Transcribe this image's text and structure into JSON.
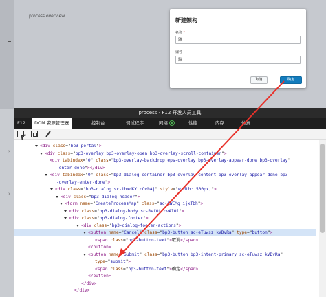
{
  "app": {
    "page_title": "process overview"
  },
  "dialog": {
    "title": "新建架构",
    "name_label": "名称",
    "required_mark": "*",
    "name_value": "跌",
    "code_label": "编号",
    "code_value": "跌",
    "cancel_label": "取消",
    "ok_label": "确定"
  },
  "devtools": {
    "window_title": "process - F12 开发人员工具",
    "tabs": [
      "F12",
      "DOM 资源管理器",
      "控制台",
      "调试程序",
      "网络",
      "性能",
      "内存",
      "仿真"
    ],
    "active_tab": "DOM 资源管理器",
    "dom_lines": [
      [
        [
          "tg",
          "<div "
        ],
        [
          "an",
          "class"
        ],
        [
          "tx",
          "=\""
        ],
        [
          "av",
          "bp3-portal"
        ],
        [
          "tx",
          "\""
        ],
        [
          "tg",
          ">"
        ]
      ],
      [
        [
          "tg",
          "<div "
        ],
        [
          "an",
          "class"
        ],
        [
          "tx",
          "=\""
        ],
        [
          "av",
          "bp3-overlay bp3-overlay-open bp3-overlay-scroll-container"
        ],
        [
          "tx",
          "\""
        ],
        [
          "tg",
          ">"
        ]
      ],
      [
        [
          "tg",
          "<div "
        ],
        [
          "an",
          "tabindex"
        ],
        [
          "tx",
          "=\""
        ],
        [
          "av",
          "0"
        ],
        [
          "tx",
          "\" "
        ],
        [
          "an",
          "class"
        ],
        [
          "tx",
          "=\""
        ],
        [
          "av",
          "bp3-overlay-backdrop eps-overlay bp3-overlay-appear-done bp3-overlay"
        ],
        [
          "tx",
          "\""
        ]
      ],
      [
        [
          "av",
          "-enter-done"
        ],
        [
          "tx",
          "\""
        ],
        [
          "tg",
          "></div>"
        ]
      ],
      [
        [
          "tg",
          "<div "
        ],
        [
          "an",
          "tabindex"
        ],
        [
          "tx",
          "=\""
        ],
        [
          "av",
          "0"
        ],
        [
          "tx",
          "\" "
        ],
        [
          "an",
          "class"
        ],
        [
          "tx",
          "=\""
        ],
        [
          "av",
          "bp3-dialog-container bp3-overlay-content bp3-overlay-appear-done bp3"
        ]
      ],
      [
        [
          "av",
          "-overlay-enter-done"
        ],
        [
          "tx",
          "\""
        ],
        [
          "tg",
          ">"
        ]
      ],
      [
        [
          "tg",
          "<div "
        ],
        [
          "an",
          "class"
        ],
        [
          "tx",
          "=\""
        ],
        [
          "av",
          "bp3-dialog sc-ibxdKY cOvhAj"
        ],
        [
          "tx",
          "\" "
        ],
        [
          "an",
          "style"
        ],
        [
          "tx",
          "=\""
        ],
        [
          "av",
          "width: 500px;"
        ],
        [
          "tx",
          "\""
        ],
        [
          "tg",
          ">"
        ]
      ],
      [
        [
          "tg",
          "<div "
        ],
        [
          "an",
          "class"
        ],
        [
          "tx",
          "=\""
        ],
        [
          "av",
          "bp3-dialog-header"
        ],
        [
          "tx",
          "\""
        ],
        [
          "tg",
          ">"
        ]
      ],
      [
        [
          "tg",
          "<form "
        ],
        [
          "an",
          "name"
        ],
        [
          "tx",
          "=\""
        ],
        [
          "av",
          "CreateProcessMap"
        ],
        [
          "tx",
          "\" "
        ],
        [
          "an",
          "class"
        ],
        [
          "tx",
          "=\""
        ],
        [
          "av",
          "sc-AWEMg ijxTbh"
        ],
        [
          "tx",
          "\""
        ],
        [
          "tg",
          ">"
        ]
      ],
      [
        [
          "tg",
          "<div "
        ],
        [
          "an",
          "class"
        ],
        [
          "tx",
          "=\""
        ],
        [
          "av",
          "bp3-dialog-body sc-RefOt cvAIOl"
        ],
        [
          "tx",
          "\""
        ],
        [
          "tg",
          ">"
        ]
      ],
      [
        [
          "tg",
          "<div "
        ],
        [
          "an",
          "class"
        ],
        [
          "tx",
          "=\""
        ],
        [
          "av",
          "bp3-dialog-footer"
        ],
        [
          "tx",
          "\""
        ],
        [
          "tg",
          ">"
        ]
      ],
      [
        [
          "tg",
          "<div "
        ],
        [
          "an",
          "class"
        ],
        [
          "tx",
          "=\""
        ],
        [
          "av",
          "bp3-dialog-footer-actions"
        ],
        [
          "tx",
          "\""
        ],
        [
          "tg",
          ">"
        ]
      ],
      [
        [
          "tg",
          "<button "
        ],
        [
          "an",
          "name"
        ],
        [
          "tx",
          "=\""
        ],
        [
          "av",
          "Cancel"
        ],
        [
          "tx",
          "\" "
        ],
        [
          "an",
          "class"
        ],
        [
          "tx",
          "=\""
        ],
        [
          "av",
          "bp3-button sc-eTuwsz kVDvRa"
        ],
        [
          "tx",
          "\" "
        ],
        [
          "an",
          "type"
        ],
        [
          "tx",
          "=\""
        ],
        [
          "av",
          "button"
        ],
        [
          "tx",
          "\""
        ],
        [
          "tg",
          ">"
        ]
      ],
      [
        [
          "tg",
          "<span "
        ],
        [
          "an",
          "class"
        ],
        [
          "tx",
          "=\""
        ],
        [
          "av",
          "bp3-button-text"
        ],
        [
          "tx",
          "\""
        ],
        [
          "tg",
          ">"
        ],
        [
          "tx",
          "取消"
        ],
        [
          "tg",
          "</span>"
        ]
      ],
      [
        [
          "tg",
          "</button>"
        ]
      ],
      [
        [
          "tg",
          "<button "
        ],
        [
          "an",
          "name"
        ],
        [
          "tx",
          "=\""
        ],
        [
          "av",
          "Submit"
        ],
        [
          "tx",
          "\" "
        ],
        [
          "an",
          "class"
        ],
        [
          "tx",
          "=\""
        ],
        [
          "av",
          "bp3-button bp3-intent-primary sc-eTuwsz kVDvRa"
        ],
        [
          "tx",
          "\""
        ]
      ],
      [
        [
          "an",
          "type"
        ],
        [
          "tx",
          "=\""
        ],
        [
          "av",
          "submit"
        ],
        [
          "tx",
          "\""
        ],
        [
          "tg",
          ">"
        ]
      ],
      [
        [
          "tg",
          "<span "
        ],
        [
          "an",
          "class"
        ],
        [
          "tx",
          "=\""
        ],
        [
          "av",
          "bp3-button-text"
        ],
        [
          "tx",
          "\""
        ],
        [
          "tg",
          ">"
        ],
        [
          "tx",
          "确定"
        ],
        [
          "tg",
          "</span>"
        ]
      ],
      [
        [
          "tg",
          "</button>"
        ]
      ],
      [
        [
          "tg",
          "</div>"
        ]
      ],
      [
        [
          "tg",
          "</div>"
        ]
      ]
    ]
  },
  "icons": {
    "picker": "select-element-icon",
    "frame": "frame-target-icon",
    "dropper": "color-picker-icon",
    "network_play": "play-icon"
  }
}
